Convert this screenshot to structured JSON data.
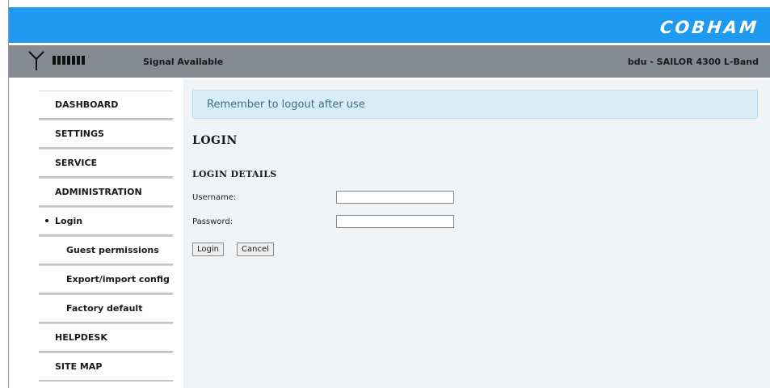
{
  "header": {
    "brand": "COBHAM"
  },
  "status": {
    "signal_bars": 7,
    "signal_text": "Signal Available",
    "device": "bdu - SAILOR 4300 L-Band"
  },
  "sidebar": {
    "items": [
      {
        "label": "DASHBOARD"
      },
      {
        "label": "SETTINGS"
      },
      {
        "label": "SERVICE"
      },
      {
        "label": "ADMINISTRATION"
      },
      {
        "label": "Login",
        "active": true
      },
      {
        "label": "Guest permissions"
      },
      {
        "label": "Export/import config"
      },
      {
        "label": "Factory default"
      },
      {
        "label": "HELPDESK"
      },
      {
        "label": "SITE MAP"
      }
    ]
  },
  "main": {
    "notice": "Remember to logout after use",
    "title": "LOGIN",
    "section": "LOGIN DETAILS",
    "username_label": "Username:",
    "username_value": "",
    "password_label": "Password:",
    "password_value": "",
    "login_button": "Login",
    "cancel_button": "Cancel"
  },
  "colors": {
    "header_blue": "#1e9af0",
    "status_gray": "#858b90",
    "notice_bg": "#d9edf7",
    "notice_text": "#3e6d8a"
  }
}
